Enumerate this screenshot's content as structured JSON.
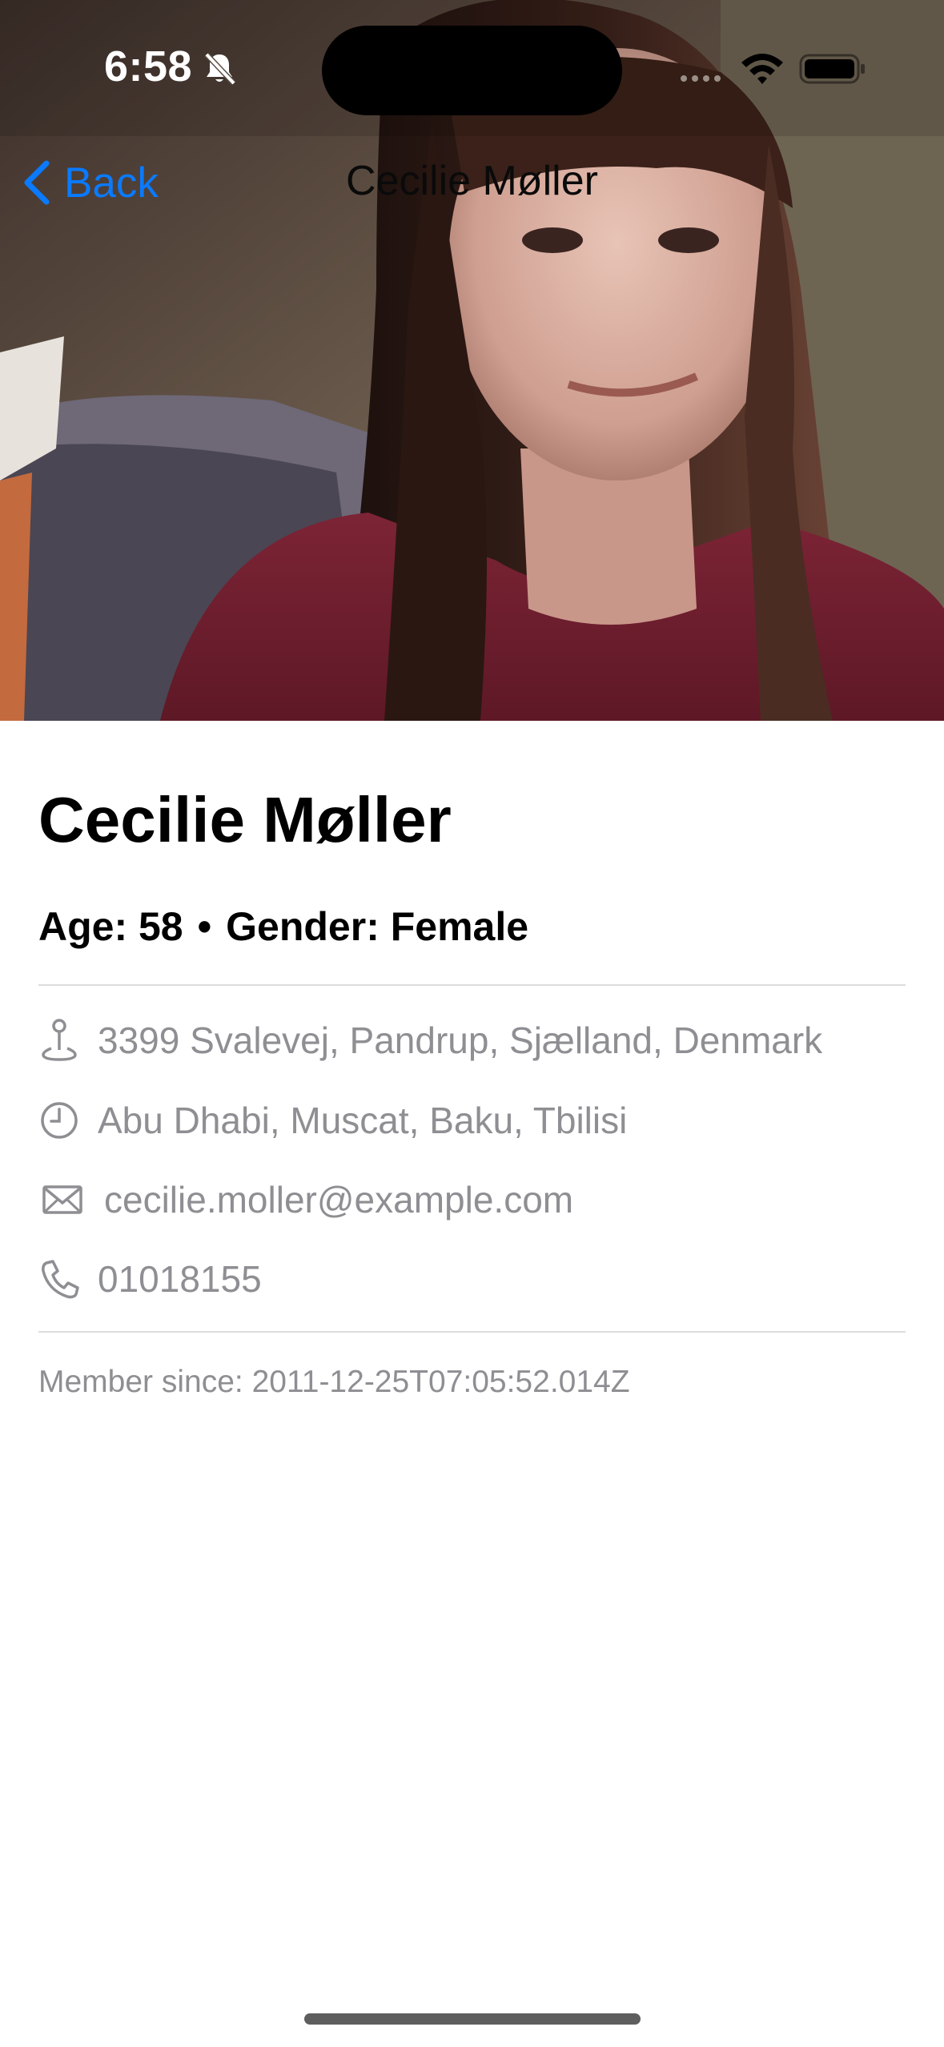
{
  "status_bar": {
    "time": "6:58",
    "icons": [
      "bell-slash-icon",
      "cellular-icon",
      "wifi-icon",
      "battery-icon"
    ]
  },
  "nav": {
    "back_label": "Back",
    "title": "Cecilie Møller",
    "accent_color": "#0a7aff"
  },
  "hero": {
    "image": "profile-photo"
  },
  "profile": {
    "name": "Cecilie Møller",
    "age_text": "Age: 58",
    "separator": "•",
    "gender_text": "Gender: Female",
    "details": [
      {
        "icon": "location-pin-icon",
        "text": "3399 Svalevej, Pandrup, Sjælland, Denmark"
      },
      {
        "icon": "clock-icon",
        "text": "Abu Dhabi, Muscat, Baku, Tbilisi"
      },
      {
        "icon": "envelope-icon",
        "text": "cecilie.moller@example.com"
      },
      {
        "icon": "phone-icon",
        "text": "01018155"
      }
    ],
    "member_since": "Member since: 2011-12-25T07:05:52.014Z",
    "secondary_text_color": "#8e8e93"
  }
}
